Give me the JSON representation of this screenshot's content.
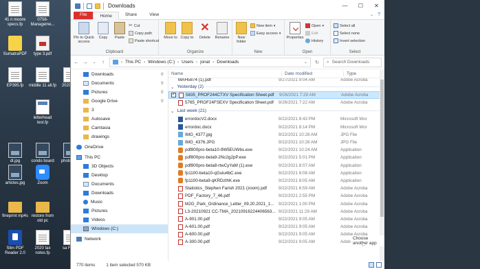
{
  "desktop": {
    "icons": [
      {
        "label": "41 n moore specs.fp",
        "kind": "doc"
      },
      {
        "label": "0758-Manageme...",
        "kind": "doc"
      },
      {
        "label": "SumatraPDF",
        "kind": "sumatra"
      },
      {
        "label": "type 3.pdf",
        "kind": "pdf"
      },
      {
        "label": "EP395.fp",
        "kind": "doc"
      },
      {
        "label": "middle 11 all.fp",
        "kind": "doc"
      },
      {
        "label": "2020 esti",
        "kind": "doc"
      },
      {
        "label": "letterhead test.fp",
        "kind": "letter"
      },
      {
        "label": "dl.jpg",
        "kind": "img"
      },
      {
        "label": "condo board",
        "kind": "img"
      },
      {
        "label": "photo cha",
        "kind": "img"
      },
      {
        "label": "articles.jpg",
        "kind": "img"
      },
      {
        "label": "Zoom",
        "kind": "zoom"
      },
      {
        "label": "fineprint mp4s",
        "kind": "folder"
      },
      {
        "label": "restore from old pc",
        "kind": "folder"
      },
      {
        "label": "Slim PDF Reader 2.0",
        "kind": "slim"
      },
      {
        "label": "2020 tax notes.fp",
        "kind": "doc"
      },
      {
        "label": "sa Form",
        "kind": "doc"
      }
    ]
  },
  "window": {
    "title": "Downloads",
    "controls": {
      "minimize": "—",
      "maximize": "☐",
      "close": "✕"
    },
    "help": "?"
  },
  "tabs": [
    {
      "label": "File",
      "id": "file"
    },
    {
      "label": "Home",
      "id": "home"
    },
    {
      "label": "Share",
      "id": "share"
    },
    {
      "label": "View",
      "id": "view"
    }
  ],
  "ribbon": {
    "clipboard": {
      "label": "Clipboard",
      "pin": "Pin to Quick access",
      "copy": "Copy",
      "paste": "Paste",
      "cut": "Cut",
      "copy_path": "Copy path",
      "paste_shortcut": "Paste shortcut"
    },
    "organize": {
      "label": "Organize",
      "move_to": "Move to",
      "copy_to": "Copy to",
      "delete": "Delete",
      "rename": "Rename"
    },
    "new": {
      "label": "New",
      "new_folder": "New folder",
      "new_item": "New item",
      "easy_access": "Easy access"
    },
    "open": {
      "label": "Open",
      "properties": "Properties",
      "open": "Open",
      "edit": "Edit",
      "history": "History"
    },
    "select": {
      "label": "Select",
      "select_all": "Select all",
      "select_none": "Select none",
      "invert": "Invert selection"
    }
  },
  "address": {
    "crumbs": [
      "This PC",
      "Windows (C:)",
      "Users",
      "jonat",
      "Downloads"
    ],
    "search_placeholder": "Search Downloads"
  },
  "nav": {
    "items": [
      {
        "label": "Downloads",
        "icon": "blue",
        "pinned": true,
        "indent": 1
      },
      {
        "label": "Documents",
        "icon": "docs",
        "pinned": true,
        "indent": 1
      },
      {
        "label": "Pictures",
        "icon": "blue",
        "pinned": true,
        "indent": 1
      },
      {
        "label": "Google Drive",
        "icon": "folder",
        "pinned": true,
        "indent": 1
      },
      {
        "label": "3",
        "icon": "folder",
        "pinned": false,
        "indent": 1
      },
      {
        "label": "Autosave",
        "icon": "folder",
        "pinned": false,
        "indent": 1
      },
      {
        "label": "Camtasia",
        "icon": "folder",
        "pinned": false,
        "indent": 1
      },
      {
        "label": "drawings",
        "icon": "folder",
        "pinned": false,
        "indent": 1
      },
      {
        "label": "OneDrive",
        "icon": "cloud",
        "pinned": false,
        "indent": 0
      },
      {
        "label": "This PC",
        "icon": "pc",
        "pinned": false,
        "indent": 0
      },
      {
        "label": "3D Objects",
        "icon": "blue",
        "pinned": false,
        "indent": 1
      },
      {
        "label": "Desktop",
        "icon": "blue",
        "pinned": false,
        "indent": 1
      },
      {
        "label": "Documents",
        "icon": "docs",
        "pinned": false,
        "indent": 1
      },
      {
        "label": "Downloads",
        "icon": "blue",
        "pinned": false,
        "indent": 1
      },
      {
        "label": "Music",
        "icon": "music",
        "pinned": false,
        "indent": 1
      },
      {
        "label": "Pictures",
        "icon": "blue",
        "pinned": false,
        "indent": 1
      },
      {
        "label": "Videos",
        "icon": "blue",
        "pinned": false,
        "indent": 1
      },
      {
        "label": "Windows (C:)",
        "icon": "drive",
        "pinned": false,
        "indent": 1,
        "selected": true
      },
      {
        "label": "Network",
        "icon": "net",
        "pinned": false,
        "indent": 0
      }
    ]
  },
  "columns": {
    "name": "Name",
    "date": "Date modified",
    "type": "Type"
  },
  "groups": {
    "partial_row": {
      "name": "MAH5874 (1).pdf",
      "date": "9/27/2021 9:04 AM",
      "type": "Adobe Acroba"
    },
    "yesterday": {
      "title": "Yesterday (2)",
      "rows": [
        {
          "name": "5835_PROF244CTXV Specification Sheet.pdf",
          "date": "9/26/2021 7:29 AM",
          "type": "Adobe Acroba",
          "icon": "pdf",
          "selected": true
        },
        {
          "name": "5765_PROF24FSEXV Specification Sheet.pdf",
          "date": "9/26/2021 7:22 AM",
          "type": "Adobe Acroba",
          "icon": "pdf"
        }
      ]
    },
    "lastweek": {
      "title": "Last week (21)",
      "rows": [
        {
          "name": "errordocV2.docx",
          "date": "9/22/2021 8:43 PM",
          "type": "Microsoft Wor",
          "icon": "doc"
        },
        {
          "name": "errordoc.docx",
          "date": "9/22/2021 8:14 PM",
          "type": "Microsoft Wor",
          "icon": "doc"
        },
        {
          "name": "IMG_4377.jpg",
          "date": "9/22/2021 10:28 AM",
          "type": "JPG File",
          "icon": "jpg"
        },
        {
          "name": "IMG_4376.JPG",
          "date": "9/22/2021 10:28 AM",
          "type": "JPG File",
          "icon": "jpg"
        },
        {
          "name": "pdf800pro-beta10-9W5EUWbs.exe",
          "date": "9/22/2021 10:24 AM",
          "type": "Application",
          "icon": "app"
        },
        {
          "name": "pdf800pro-beta9-2Nc2g2pP.exe",
          "date": "9/22/2021 5:01 PM",
          "type": "Application",
          "icon": "app"
        },
        {
          "name": "pdf800pro-beta8-rtwCyYaM (1).exe",
          "date": "9/22/2021 8:07 AM",
          "type": "Application",
          "icon": "app"
        },
        {
          "name": "fp1100-beta10-qGulu4bC.exe",
          "date": "9/22/2021 8:08 AM",
          "type": "Application",
          "icon": "app"
        },
        {
          "name": "fp1100-beta9-qKRDzthK.exe",
          "date": "9/22/2021 8:05 AM",
          "type": "Application",
          "icon": "app"
        },
        {
          "name": "Statistics_Stephen Farish 2021 (zoom).pdf",
          "date": "9/22/2021 6:59 AM",
          "type": "Adobe Acroba",
          "icon": "pdf"
        },
        {
          "name": "PDF_Factory_7_46.pdf",
          "date": "9/22/2021 2:55 PM",
          "type": "Adobe Acroba",
          "icon": "pdf"
        },
        {
          "name": "M2G_Park_Ordinance_Letter_09.20.2021_1...",
          "date": "9/22/2021 1:00 PM",
          "type": "Adobe Acroba",
          "icon": "pdf"
        },
        {
          "name": "L3-20210921 CC-TMA_20210916224406563...",
          "date": "9/22/2021 11:29 AM",
          "type": "Adobe Acroba",
          "icon": "pdf"
        },
        {
          "name": "A-901.00.pdf",
          "date": "9/22/2021 9:05 AM",
          "type": "Adobe Acroba",
          "icon": "pdf"
        },
        {
          "name": "A-601.00.pdf",
          "date": "9/22/2021 9:05 AM",
          "type": "Adobe Acroba",
          "icon": "pdf"
        },
        {
          "name": "A-600.00.pdf",
          "date": "9/22/2021 9:05 AM",
          "type": "Adobe Acroba",
          "icon": "pdf"
        },
        {
          "name": "A-300.00.pdf",
          "date": "9/22/2021 9:05 AM",
          "type": "Adobe Acroba",
          "icon": "pdf"
        }
      ]
    }
  },
  "tooltip": "Choose another app",
  "status": {
    "item_count": "770 items",
    "selection": "1 item selected  570 KB"
  }
}
